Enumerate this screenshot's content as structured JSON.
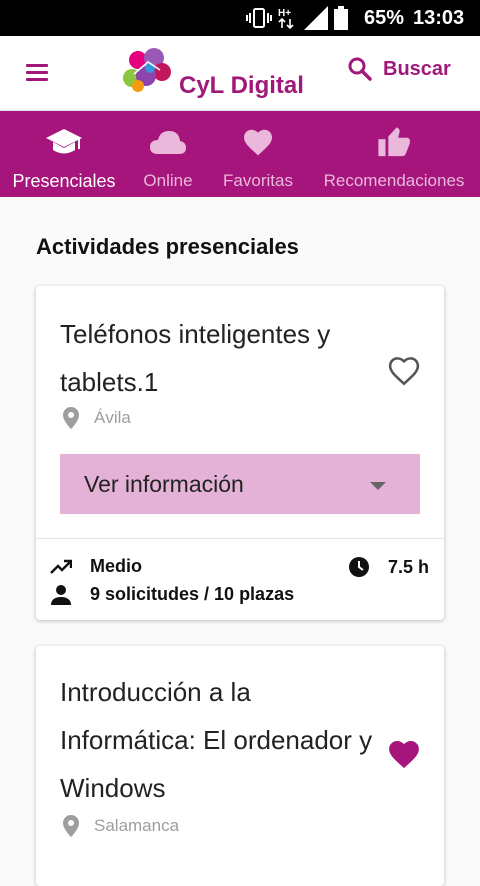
{
  "status_bar": {
    "battery_percent": "65%",
    "time": "13:03",
    "network": "H+"
  },
  "app_bar": {
    "brand": "CyL Digital",
    "search_label": "Buscar"
  },
  "tabs": [
    {
      "label": "Presenciales",
      "icon": "graduation-cap-icon",
      "active": true
    },
    {
      "label": "Online",
      "icon": "cloud-icon",
      "active": false
    },
    {
      "label": "Favoritas",
      "icon": "heart-icon",
      "active": false
    },
    {
      "label": "Recomendaciones",
      "icon": "thumbs-up-icon",
      "active": false
    }
  ],
  "section_title": "Actividades presenciales",
  "activities": [
    {
      "title_line1": "Teléfonos inteligentes y",
      "title_line2": "tablets.1",
      "location": "Ávila",
      "favorite": false,
      "info_button": "Ver información",
      "level": "Medio",
      "duration": "7.5 h",
      "requests": "9 solicitudes / 10 plazas"
    },
    {
      "title_line1": "Introducción a la",
      "title_line2": "Informática: El ordenador y",
      "title_line3": "Windows",
      "location": "Salamanca",
      "favorite": true
    }
  ],
  "colors": {
    "primary": "#a5157c",
    "accent_text": "#a0187a",
    "info_button_bg": "#e3b2d6",
    "tab_inactive": "#e9b8da"
  }
}
